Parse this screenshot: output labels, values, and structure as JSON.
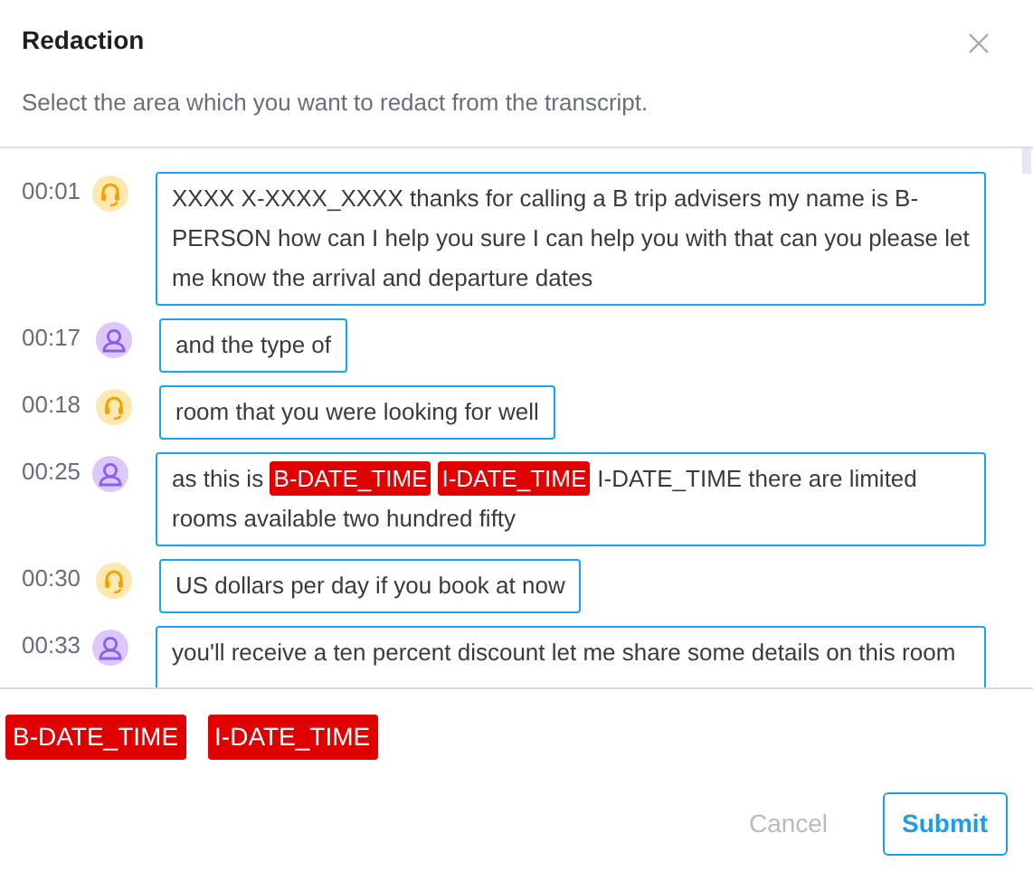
{
  "dialog": {
    "title": "Redaction",
    "subtitle": "Select the area which you want to redact from the transcript."
  },
  "messages": [
    {
      "time": "00:01",
      "kind": "agent",
      "segments": [
        {
          "text": "XXXX X-XXXX_XXXX thanks for calling a B trip advisers my name is B-PERSON how can I help you sure I can help you with that can you please let me know the arrival and departure dates",
          "redacted": false
        }
      ]
    },
    {
      "time": "00:17",
      "kind": "customer",
      "segments": [
        {
          "text": "and the type of",
          "redacted": false
        }
      ]
    },
    {
      "time": "00:18",
      "kind": "agent",
      "segments": [
        {
          "text": "room that you were looking for well",
          "redacted": false
        }
      ]
    },
    {
      "time": "00:25",
      "kind": "customer",
      "segments": [
        {
          "text": "as this is",
          "redacted": false
        },
        {
          "text": "B-DATE_TIME",
          "redacted": true
        },
        {
          "text": "I-DATE_TIME",
          "redacted": true
        },
        {
          "text": "I-DATE_TIME there are limited rooms available two hundred fifty",
          "redacted": false
        }
      ]
    },
    {
      "time": "00:30",
      "kind": "agent",
      "segments": [
        {
          "text": "US dollars per day if you book at now",
          "redacted": false
        }
      ]
    },
    {
      "time": "00:33",
      "kind": "customer",
      "segments": [
        {
          "text": "you'll receive a ten percent discount let me share some details on this room",
          "redacted": false
        }
      ]
    }
  ],
  "selected_tags": [
    "B-DATE_TIME",
    "I-DATE_TIME"
  ],
  "buttons": {
    "cancel": {
      "label": "Cancel",
      "disabled": true
    },
    "submit": {
      "label": "Submit"
    }
  }
}
